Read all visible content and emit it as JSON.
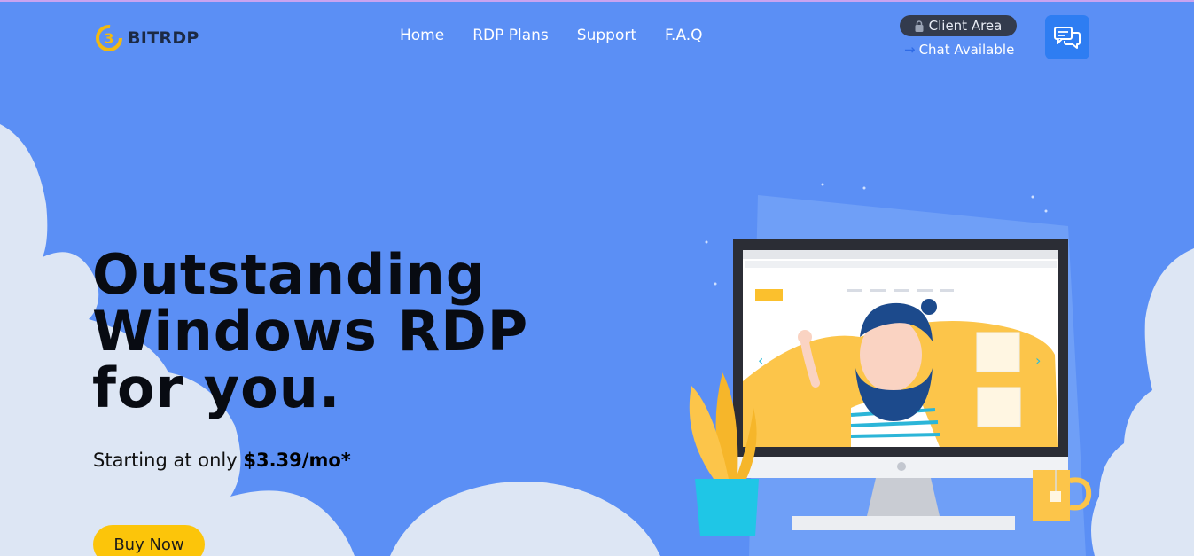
{
  "brand": {
    "name": "BITRDP",
    "mark_letter": "B"
  },
  "nav": {
    "items": [
      {
        "label": "Home"
      },
      {
        "label": "RDP Plans"
      },
      {
        "label": "Support"
      },
      {
        "label": "F.A.Q"
      }
    ]
  },
  "account": {
    "client_area": "Client Area",
    "chat_status": "Chat Available",
    "chat_icon": "chat-bubbles-icon",
    "lock_icon": "lock-icon"
  },
  "hero": {
    "title_lines": [
      "Outstanding",
      "Windows RDP",
      "for you."
    ],
    "price_prefix": "Starting at only",
    "price": "$3.39/mo*",
    "cta": "Buy Now"
  },
  "colors": {
    "background": "#5b8ff5",
    "cloud": "#dde6f4",
    "cta": "#fcc50a",
    "chat_button": "#2e7df2",
    "pill": "#333b4d"
  }
}
